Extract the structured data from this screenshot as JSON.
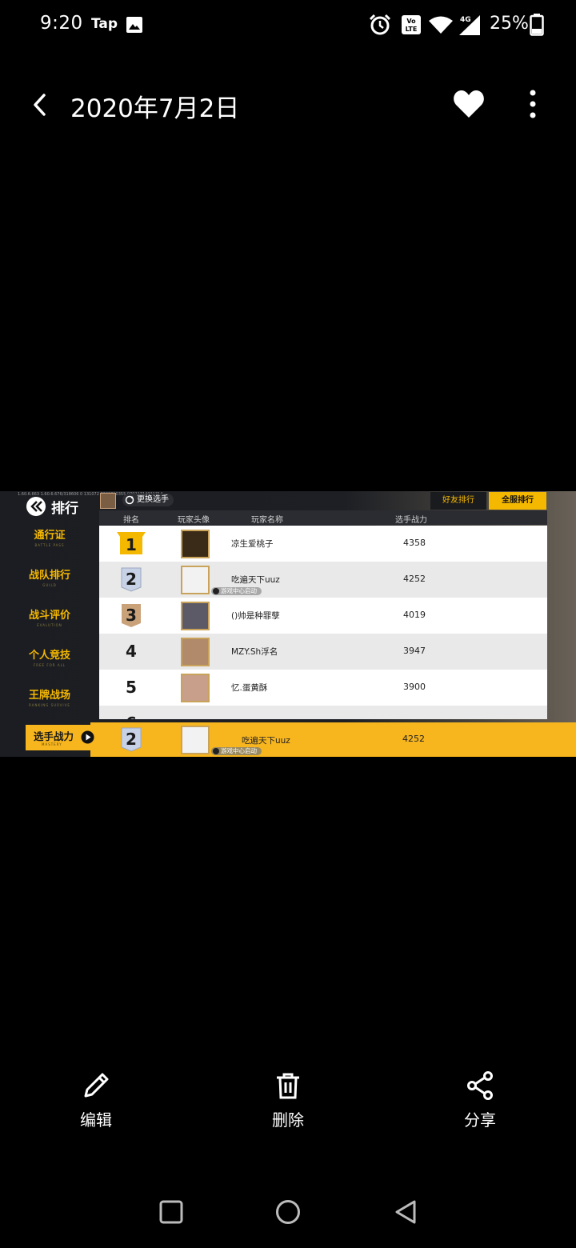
{
  "status_bar": {
    "time": "9:20",
    "tap_label": "Tap",
    "battery": "25%",
    "icons": [
      "gallery-icon",
      "alarm-icon",
      "volte-icon",
      "wifi-icon",
      "signal-4g-icon",
      "battery-icon"
    ],
    "network": "4G"
  },
  "header": {
    "title": "2020年7月2日",
    "icons": [
      "back-arrow-icon",
      "heart-icon",
      "more-vert-icon"
    ]
  },
  "game": {
    "build_text": "1.60.6.663  1.60.6.676/318606  0  131072  7238810355  07021714021714",
    "title": "排行",
    "change_player": "更换选手",
    "tabs": [
      "好友排行",
      "全服排行"
    ],
    "active_tab": "全服排行",
    "columns": [
      "排名",
      "玩家头像",
      "玩家名称",
      "选手战力"
    ],
    "sidebar": [
      {
        "zh": "通行证",
        "en": "BATTLE PASS"
      },
      {
        "zh": "战队排行",
        "en": "GUILD"
      },
      {
        "zh": "战斗评价",
        "en": "EVALUTION"
      },
      {
        "zh": "个人竞技",
        "en": "FREE FOR ALL"
      },
      {
        "zh": "王牌战场",
        "en": "RANKING SURVIVE"
      }
    ],
    "rows": [
      {
        "rank": "1",
        "name": "凉生爱桃子",
        "power": "4358",
        "tag": ""
      },
      {
        "rank": "2",
        "name": "吃遍天下uuz",
        "power": "4252",
        "tag": "游戏中心启动"
      },
      {
        "rank": "3",
        "name": "()帅是种罪孽",
        "power": "4019",
        "tag": ""
      },
      {
        "rank": "4",
        "name": "MZY.Sh浮名",
        "power": "3947",
        "tag": ""
      },
      {
        "rank": "5",
        "name": "忆.蛋黄酥",
        "power": "3900",
        "tag": ""
      },
      {
        "rank": "6",
        "name": "",
        "power": "",
        "tag": ""
      }
    ],
    "my_rank": {
      "label": "选手战力",
      "label_en": "MASTERY",
      "rank": "2",
      "name": "吃遍天下uuz",
      "power": "4252",
      "tag": "游戏中心启动"
    },
    "colors": {
      "accent": "#f7b51e",
      "gold": "#f5b800",
      "silver": "#c8d2e6",
      "bronze": "#c9a27a"
    }
  },
  "actions": [
    {
      "label": "编辑",
      "icon": "pencil-icon"
    },
    {
      "label": "删除",
      "icon": "trash-icon"
    },
    {
      "label": "分享",
      "icon": "share-icon"
    }
  ],
  "nav": [
    "recents-square-icon",
    "home-circle-icon",
    "back-triangle-icon"
  ]
}
